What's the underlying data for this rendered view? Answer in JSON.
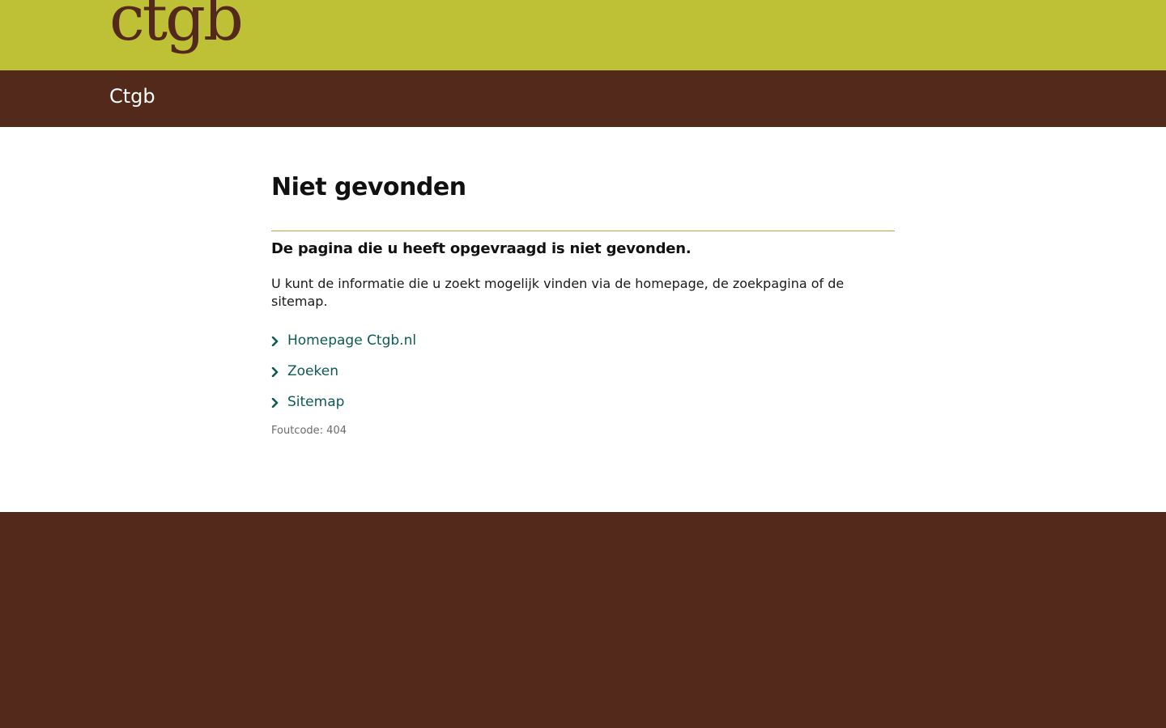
{
  "header": {
    "logo_text": "ctgb",
    "site_name": "Ctgb"
  },
  "main": {
    "title": "Niet gevonden",
    "subheading": "De pagina die u heeft opgevraagd is niet gevonden.",
    "intro": "U kunt de informatie die u zoekt mogelijk vinden via de homepage, de zoekpagina of de sitemap.",
    "links": [
      {
        "label": "Homepage Ctgb.nl",
        "icon": "chevron-right-icon"
      },
      {
        "label": "Zoeken",
        "icon": "chevron-right-icon"
      },
      {
        "label": "Sitemap",
        "icon": "chevron-right-icon"
      }
    ],
    "error_code": "Foutcode: 404"
  },
  "colors": {
    "top_bar": "#bec036",
    "brand_brown": "#52291b",
    "link_teal": "#0e5a58",
    "divider_gold": "#bfa94a"
  }
}
